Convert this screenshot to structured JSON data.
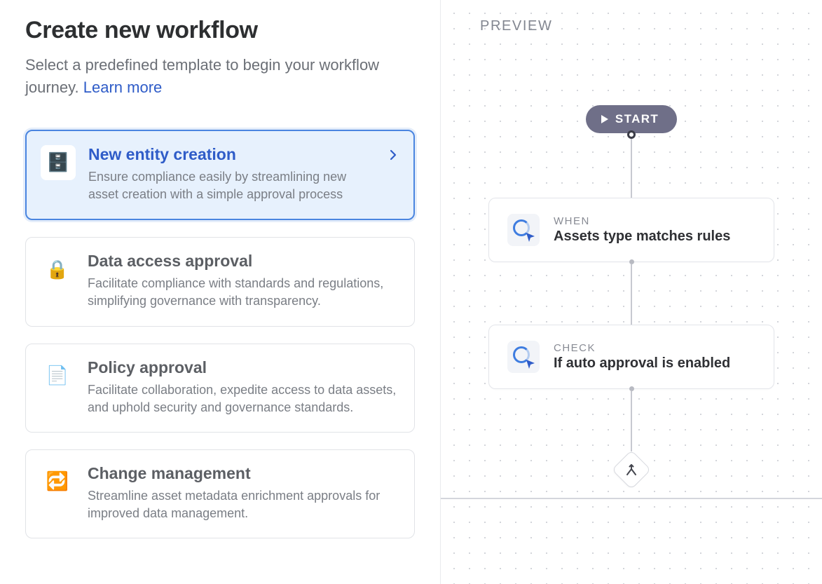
{
  "header": {
    "title": "Create new workflow",
    "subtitle_prefix": "Select a predefined template to begin your workflow journey. ",
    "learn_more": "Learn more"
  },
  "templates": [
    {
      "icon": "🗄️",
      "title": "New entity creation",
      "desc": "Ensure compliance easily by streamlining new asset creation with a simple approval process",
      "selected": true
    },
    {
      "icon": "🔒",
      "title": "Data access approval",
      "desc": "Facilitate compliance with standards and regulations, simplifying governance with transparency.",
      "selected": false
    },
    {
      "icon": "📄",
      "title": "Policy approval",
      "desc": "Facilitate collaboration, expedite access to data assets, and uphold security and governance standards.",
      "selected": false
    },
    {
      "icon": "🔁",
      "title": "Change management",
      "desc": "Streamline asset metadata enrichment approvals for improved data management.",
      "selected": false
    }
  ],
  "preview": {
    "label": "PREVIEW",
    "start_label": "START",
    "nodes": [
      {
        "eyebrow": "WHEN",
        "main": "Assets type matches rules"
      },
      {
        "eyebrow": "CHECK",
        "main": "If auto approval is enabled"
      }
    ]
  }
}
